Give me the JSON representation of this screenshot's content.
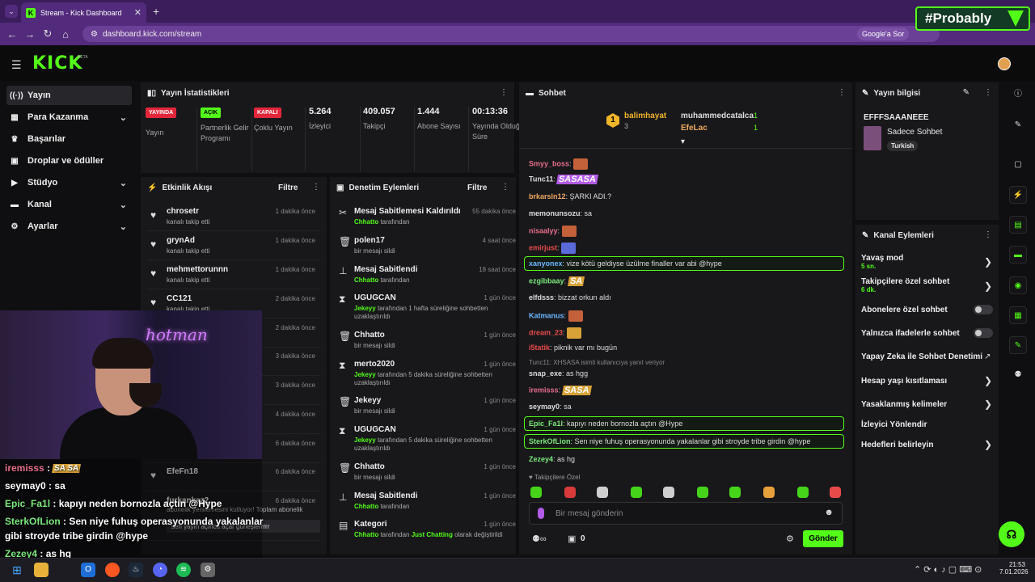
{
  "browser": {
    "tab_title": "Stream - Kick Dashboard",
    "url": "dashboard.kick.com/stream",
    "google_search": "Google'a Sor",
    "overlay_brand": "#Probably"
  },
  "sidebar": {
    "items": [
      {
        "label": "Yayın"
      },
      {
        "label": "Para Kazanma"
      },
      {
        "label": "Başarılar"
      },
      {
        "label": "Droplar ve ödüller"
      },
      {
        "label": "Stüdyo"
      },
      {
        "label": "Kanal"
      },
      {
        "label": "Ayarlar"
      }
    ]
  },
  "stats": {
    "title": "Yayın İstatistikleri",
    "items": [
      {
        "badge": "YAYINDA",
        "label": "Yayın"
      },
      {
        "badge": "AÇIK",
        "label": "Partnerlik Gelir Programı"
      },
      {
        "badge": "KAPALI",
        "label": "Çoklu Yayın"
      },
      {
        "value": "5.264",
        "label": "İzleyici"
      },
      {
        "value": "409.057",
        "label": "Takipçi"
      },
      {
        "value": "1.444",
        "label": "Abone Sayısı"
      },
      {
        "value": "00:13:36",
        "label": "Yayında Olduğu Süre"
      }
    ]
  },
  "activity": {
    "title": "Etkinlik Akışı",
    "filter": "Filtre",
    "items": [
      {
        "name": "chrosetr",
        "sub": "kanalı takip etti",
        "time": "1 dakika önce"
      },
      {
        "name": "grynAd",
        "sub": "kanalı takip etti",
        "time": "1 dakika önce"
      },
      {
        "name": "mehmettorunnn",
        "sub": "kanalı takip etti",
        "time": "1 dakika önce"
      },
      {
        "name": "CC121",
        "sub": "kanalı takip etti",
        "time": "2 dakika önce"
      },
      {
        "time": "2 dakika önce"
      },
      {
        "time": "3 dakika önce"
      },
      {
        "time": "3 dakika önce"
      },
      {
        "time": "4 dakika önce"
      },
      {
        "time": "6 dakika önce"
      },
      {
        "name": "EfeFn18",
        "time": "6 dakika önce"
      },
      {
        "name": "furkankaz2",
        "time": "6 dakika önce",
        "sub": "abonelik yenilemesini kutluyor! Toplam abonelik"
      }
    ],
    "note": "sen yayın açınca açar güneşlerrrrr"
  },
  "moderation": {
    "title": "Denetim Eylemleri",
    "filter": "Filtre",
    "items": [
      {
        "name": "Mesaj Sabitlemesi Kaldırıldı",
        "time": "55 dakika önce",
        "actor": "Chhatto",
        "sub": "tarafından"
      },
      {
        "name": "polen17",
        "time": "4 saat önce",
        "sub": "bir mesajı sildi"
      },
      {
        "name": "Mesaj Sabitlendi",
        "time": "18 saat önce",
        "actor": "Chhatto",
        "sub": "tarafından"
      },
      {
        "name": "UGUGCAN",
        "time": "1 gün önce",
        "actor": "Jekeyy",
        "sub": "tarafından 1 hafta süreliğine sohbetten uzaklaştırıldı"
      },
      {
        "name": "Chhatto",
        "time": "1 gün önce",
        "sub": "bir mesajı sildi"
      },
      {
        "name": "merto2020",
        "time": "1 gün önce",
        "actor": "Jekeyy",
        "sub": "tarafından 5 dakika süreliğine sohbetten uzaklaştırıldı"
      },
      {
        "name": "Jekeyy",
        "time": "1 gün önce",
        "sub": "bir mesajı sildi"
      },
      {
        "name": "UGUGCAN",
        "time": "1 gün önce",
        "actor": "Jekeyy",
        "sub": "tarafından 5 dakika süreliğine sohbetten uzaklaştırıldı"
      },
      {
        "name": "Chhatto",
        "time": "1 gün önce",
        "sub": "bir mesajı sildi"
      },
      {
        "name": "Mesaj Sabitlendi",
        "time": "1 gün önce",
        "actor": "Chhatto",
        "sub": "tarafından"
      },
      {
        "name": "Kategori",
        "time": "1 gün önce",
        "actor": "Chhatto",
        "sub": "tarafından",
        "extra": "Just Chatting",
        "sub2": "olarak değiştirildi"
      }
    ]
  },
  "chat": {
    "title": "Sohbet",
    "leaders": [
      {
        "name": "balimhayat",
        "count": "3",
        "rank": "1"
      },
      {
        "name": "muhammedcatalca",
        "count": "1"
      },
      {
        "name": "EfeLac",
        "count": "1"
      }
    ],
    "messages": [
      {
        "user": "Smyy_boss",
        "color": "#e76f8b",
        "text": ""
      },
      {
        "user": "Tunc11",
        "color": "#e8e8e8",
        "text": "SASASA"
      },
      {
        "user": "brkarsln12",
        "color": "#f0a860",
        "text": "ŞARKI ADI.?"
      },
      {
        "user": "memonunsozu",
        "color": "#e8e8e8",
        "text": "sa"
      },
      {
        "user": "nisaalyy",
        "color": "#e76f8b",
        "text": ""
      },
      {
        "user": "emirjust",
        "color": "#e84a4a",
        "text": ""
      },
      {
        "user": "xanyonex",
        "color": "#6bb7ff",
        "text": "vize kötü geldiyse üzülme finaller var abi @hype"
      },
      {
        "user": "ezgibbaay",
        "color": "#7ce87c",
        "text": "SA"
      },
      {
        "user": "elfdsss",
        "color": "#e8e8e8",
        "text": "bizzat orkun aldı"
      },
      {
        "user": "Katmanus",
        "color": "#6bb7ff",
        "text": ""
      },
      {
        "user": "dream_23",
        "color": "#e84a4a",
        "text": ""
      },
      {
        "user": "i5tatik",
        "color": "#e84a4a",
        "text": "piknik var mı bugün"
      },
      {
        "reply": "Tunc11: XHSASA isimli kullanıcıya yanıt veriyor"
      },
      {
        "user": "snap_exe",
        "color": "#e8e8e8",
        "text": "as hgg"
      },
      {
        "user": "iremisss",
        "color": "#e76f8b",
        "text": "SASA"
      },
      {
        "user": "seymay0",
        "color": "#e8e8e8",
        "text": "sa"
      },
      {
        "user": "Epic_Fa1l",
        "color": "#7ce87c",
        "text": "kapıyı neden bornozla açtın @Hype"
      },
      {
        "user": "SterkOfLion",
        "color": "#7ce87c",
        "text": "Sen niye fuhuş operasyonunda yakalanlar gibi stroyde tribe girdin @hype"
      },
      {
        "user": "Zezey4",
        "color": "#7ce87c",
        "text": "as hg"
      }
    ],
    "mode": "Takipçilere Özel",
    "placeholder": "Bir mesaj gönderin",
    "send": "Gönder",
    "count": "0"
  },
  "stream_info": {
    "title": "Yayın bilgisi",
    "stream_title": "EFFFSAAANEEE",
    "category": "Sadece Sohbet",
    "tag": "Turkish"
  },
  "channel_actions": {
    "title": "Kanal Eylemleri",
    "items": [
      {
        "label": "Yavaş mod",
        "sub": "5 sn."
      },
      {
        "label": "Takipçilere özel sohbet",
        "sub": "6 dk."
      },
      {
        "label": "Abonelere özel sohbet"
      },
      {
        "label": "Yalnızca ifadelerle sohbet"
      },
      {
        "label": "Yapay Zeka ile Sohbet Denetimi"
      },
      {
        "label": "Hesap yaşı kısıtlaması"
      },
      {
        "label": "Yasaklanmış kelimeler"
      },
      {
        "label": "İzleyici Yönlendir"
      },
      {
        "label": "Hedefleri belirleyin"
      }
    ]
  },
  "overlay_chat": [
    {
      "user": "iremisss",
      "text": "SA SA"
    },
    {
      "user": "seymay0",
      "text": "sa"
    },
    {
      "user": "Epic_Fa1l",
      "text": "kapıyı neden bornozla açtın @Hype"
    },
    {
      "user": "SterkOfLion",
      "text": "Sen niye fuhuş operasyonunda yakalanlar"
    },
    {
      "text": "gibi stroyde tribe girdin @hype"
    },
    {
      "user": "Zezey4",
      "text": "as hg"
    }
  ],
  "taskbar": {
    "time": "21:53",
    "date": "7.01.2026"
  }
}
